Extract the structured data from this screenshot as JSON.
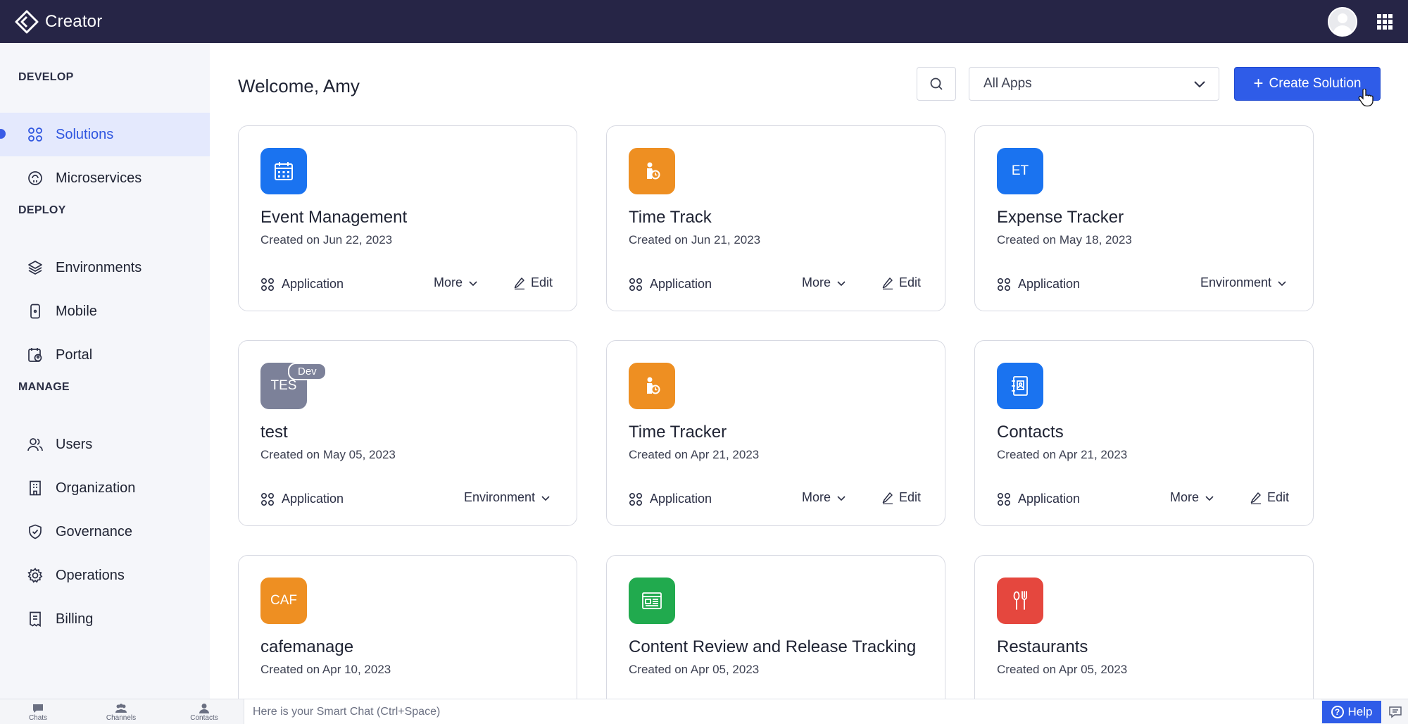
{
  "topbar": {
    "brand": "Creator"
  },
  "sidebar": {
    "sections": [
      {
        "title": "DEVELOP",
        "items": [
          {
            "label": "Solutions",
            "active": true,
            "icon": "apps-grid-icon"
          },
          {
            "label": "Microservices",
            "active": false,
            "icon": "microservices-icon"
          }
        ]
      },
      {
        "title": "DEPLOY",
        "items": [
          {
            "label": "Environments",
            "active": false,
            "icon": "layers-icon"
          },
          {
            "label": "Mobile",
            "active": false,
            "icon": "mobile-icon"
          },
          {
            "label": "Portal",
            "active": false,
            "icon": "portal-icon"
          }
        ]
      },
      {
        "title": "MANAGE",
        "items": [
          {
            "label": "Users",
            "active": false,
            "icon": "users-icon"
          },
          {
            "label": "Organization",
            "active": false,
            "icon": "building-icon"
          },
          {
            "label": "Governance",
            "active": false,
            "icon": "shield-icon"
          },
          {
            "label": "Operations",
            "active": false,
            "icon": "gear-icon"
          },
          {
            "label": "Billing",
            "active": false,
            "icon": "receipt-icon"
          }
        ]
      }
    ]
  },
  "main": {
    "welcome": "Welcome, Amy",
    "filter": {
      "selected": "All Apps"
    },
    "create_label": "Create Solution"
  },
  "cards": [
    {
      "title": "Event Management",
      "date": "Created on Jun 22, 2023",
      "type": "Application",
      "action": "More",
      "edit": "Edit",
      "icon": "calendar-icon",
      "color": "#1a73f0"
    },
    {
      "title": "Time Track",
      "date": "Created on Jun 21, 2023",
      "type": "Application",
      "action": "More",
      "edit": "Edit",
      "icon": "person-clock-icon",
      "color": "#ee8f22"
    },
    {
      "title": "Expense Tracker",
      "date": "Created on May 18, 2023",
      "type": "Application",
      "action": "Environment",
      "edit": "",
      "icon_text": "ET",
      "color": "#1a73f0"
    },
    {
      "title": "test",
      "date": "Created on May 05, 2023",
      "type": "Application",
      "action": "Environment",
      "edit": "",
      "icon_text": "TES",
      "badge": "Dev",
      "color": "#7c8199"
    },
    {
      "title": "Time Tracker",
      "date": "Created on Apr 21, 2023",
      "type": "Application",
      "action": "More",
      "edit": "Edit",
      "icon": "person-clock-icon",
      "color": "#ee8f22"
    },
    {
      "title": "Contacts",
      "date": "Created on Apr 21, 2023",
      "type": "Application",
      "action": "More",
      "edit": "Edit",
      "icon": "contact-book-icon",
      "color": "#1a73f0"
    },
    {
      "title": "cafemanage",
      "date": "Created on Apr 10, 2023",
      "icon_text": "CAF",
      "color": "#ee8f22"
    },
    {
      "title": "Content Review and Release Tracking",
      "date": "Created on Apr 05, 2023",
      "icon": "browser-window-icon",
      "color": "#21aa4e"
    },
    {
      "title": "Restaurants",
      "date": "Created on Apr 05, 2023",
      "icon": "fork-spoon-icon",
      "color": "#e5473e"
    }
  ],
  "bottombar": {
    "tabs": [
      "Chats",
      "Channels",
      "Contacts"
    ],
    "smartchat_placeholder": "Here is your Smart Chat (Ctrl+Space)",
    "help": "Help"
  }
}
